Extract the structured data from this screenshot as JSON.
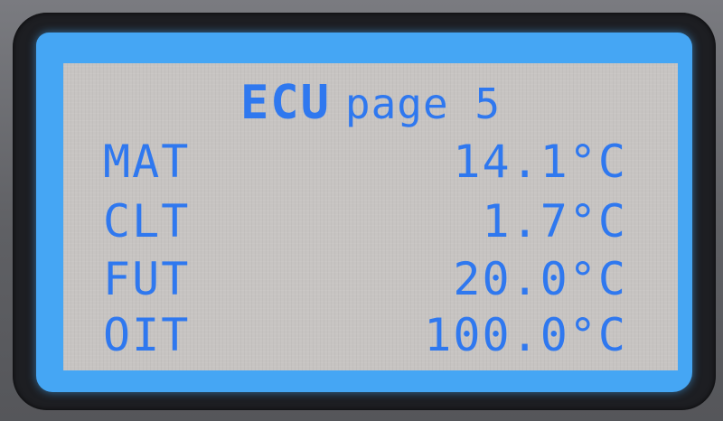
{
  "screen": {
    "title_bold": "ECU",
    "title_rest": "page 5"
  },
  "readings": [
    {
      "label": "MAT",
      "value": "14.1°C"
    },
    {
      "label": "CLT",
      "value": "1.7°C"
    },
    {
      "label": "FUT",
      "value": "20.0°C"
    },
    {
      "label": "OIT",
      "value": "100.0°C"
    }
  ],
  "colors": {
    "backlight": "#45a6f4",
    "lcd_background": "#c7c4c2",
    "text": "#2f78ef",
    "bezel": "#1d1e22"
  }
}
